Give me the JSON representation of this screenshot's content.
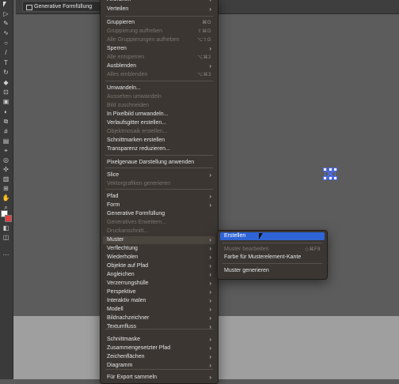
{
  "tab": {
    "label": "Generative Formfüllung"
  },
  "menu": {
    "items": [
      {
        "label": "Anordnen",
        "state": "enabled",
        "submenu": true
      },
      {
        "label": "Verteilen",
        "state": "enabled",
        "submenu": true
      },
      {
        "label": "Gruppieren",
        "state": "enabled",
        "shortcut": "⌘G"
      },
      {
        "label": "Gruppierung aufheben",
        "state": "disabled",
        "shortcut": "⇧⌘G"
      },
      {
        "label": "Alle Gruppierungen aufheben",
        "state": "disabled",
        "shortcut": "⌥⇧G"
      },
      {
        "label": "Sperren",
        "state": "enabled",
        "submenu": true
      },
      {
        "label": "Alle entsperren",
        "state": "disabled",
        "shortcut": "⌥⌘2"
      },
      {
        "label": "Ausblenden",
        "state": "enabled",
        "submenu": true
      },
      {
        "label": "Alles einblenden",
        "state": "disabled",
        "shortcut": "⌥⌘3"
      },
      {
        "label": "Umwandeln...",
        "state": "enabled"
      },
      {
        "label": "Aussehen umwandeln",
        "state": "disabled"
      },
      {
        "label": "Bild zuschneiden",
        "state": "disabled"
      },
      {
        "label": "In Pixelbild umwandeln...",
        "state": "enabled"
      },
      {
        "label": "Verlaufsgitter erstellen...",
        "state": "enabled"
      },
      {
        "label": "Objektmosaik erstellen...",
        "state": "disabled"
      },
      {
        "label": "Schnittmarken erstellen",
        "state": "enabled"
      },
      {
        "label": "Transparenz reduzieren...",
        "state": "enabled"
      },
      {
        "label": "Pixelgenaue Darstellung anwenden",
        "state": "enabled"
      },
      {
        "label": "Slice",
        "state": "enabled",
        "submenu": true
      },
      {
        "label": "Vektorgrafiken generieren",
        "state": "disabled"
      },
      {
        "label": "Pfad",
        "state": "enabled",
        "submenu": true
      },
      {
        "label": "Form",
        "state": "enabled",
        "submenu": true
      },
      {
        "label": "Generative Formfüllung",
        "state": "enabled"
      },
      {
        "label": "Generatives Erweitern...",
        "state": "disabled"
      },
      {
        "label": "Druckanschnitt...",
        "state": "disabled"
      },
      {
        "label": "Muster",
        "state": "highlight",
        "submenu": true
      },
      {
        "label": "Verflechtung",
        "state": "enabled",
        "submenu": true
      },
      {
        "label": "Wiederholen",
        "state": "enabled",
        "submenu": true
      },
      {
        "label": "Objekte auf Pfad",
        "state": "enabled",
        "submenu": true
      },
      {
        "label": "Angleichen",
        "state": "enabled",
        "submenu": true
      },
      {
        "label": "Verzerrungshülle",
        "state": "enabled",
        "submenu": true
      },
      {
        "label": "Perspektive",
        "state": "enabled",
        "submenu": true
      },
      {
        "label": "Interaktiv malen",
        "state": "enabled",
        "submenu": true
      },
      {
        "label": "Modell",
        "state": "enabled",
        "submenu": true
      },
      {
        "label": "Bildnachzeichner",
        "state": "enabled",
        "submenu": true
      },
      {
        "label": "Textumfluss",
        "state": "enabled",
        "submenu": true
      },
      {
        "label": "Schnittmaske",
        "state": "enabled",
        "submenu": true
      },
      {
        "label": "Zusammengesetzter Pfad",
        "state": "enabled",
        "submenu": true
      },
      {
        "label": "Zeichenflächen",
        "state": "enabled",
        "submenu": true
      },
      {
        "label": "Diagramm",
        "state": "enabled",
        "submenu": true
      },
      {
        "label": "Für Export sammeln",
        "state": "enabled",
        "submenu": true
      }
    ]
  },
  "submenu": {
    "items": [
      {
        "label": "Erstellen",
        "state": "active"
      },
      {
        "label": "Muster bearbeiten",
        "state": "disabled",
        "shortcut": "◇⌘F8"
      },
      {
        "label": "Farbe für Musterelement-Kante",
        "state": "enabled"
      },
      {
        "label": "Muster generieren",
        "state": "enabled"
      }
    ]
  },
  "chevron": "›",
  "icons": [
    "selection-tool-icon",
    "direct-selection-icon",
    "pen-icon",
    "curvature-icon",
    "ellipse-icon",
    "paintbrush-icon",
    "shaper-icon",
    "type-icon",
    "rotate-icon",
    "eraser-icon",
    "scale-icon",
    "warp-icon",
    "free-transform-icon",
    "shape-builder-icon",
    "perspective-icon",
    "mesh-icon",
    "gradient-icon",
    "eyedropper-icon",
    "blend-icon",
    "symbol-sprayer-icon",
    "graph-icon",
    "artboard-icon",
    "slice-icon",
    "hand-icon",
    "zoom-icon",
    "fill-stroke-icon",
    "color-mode-icon",
    "draw-mode-icon",
    "screen-mode-icon",
    "more-tools-icon"
  ]
}
